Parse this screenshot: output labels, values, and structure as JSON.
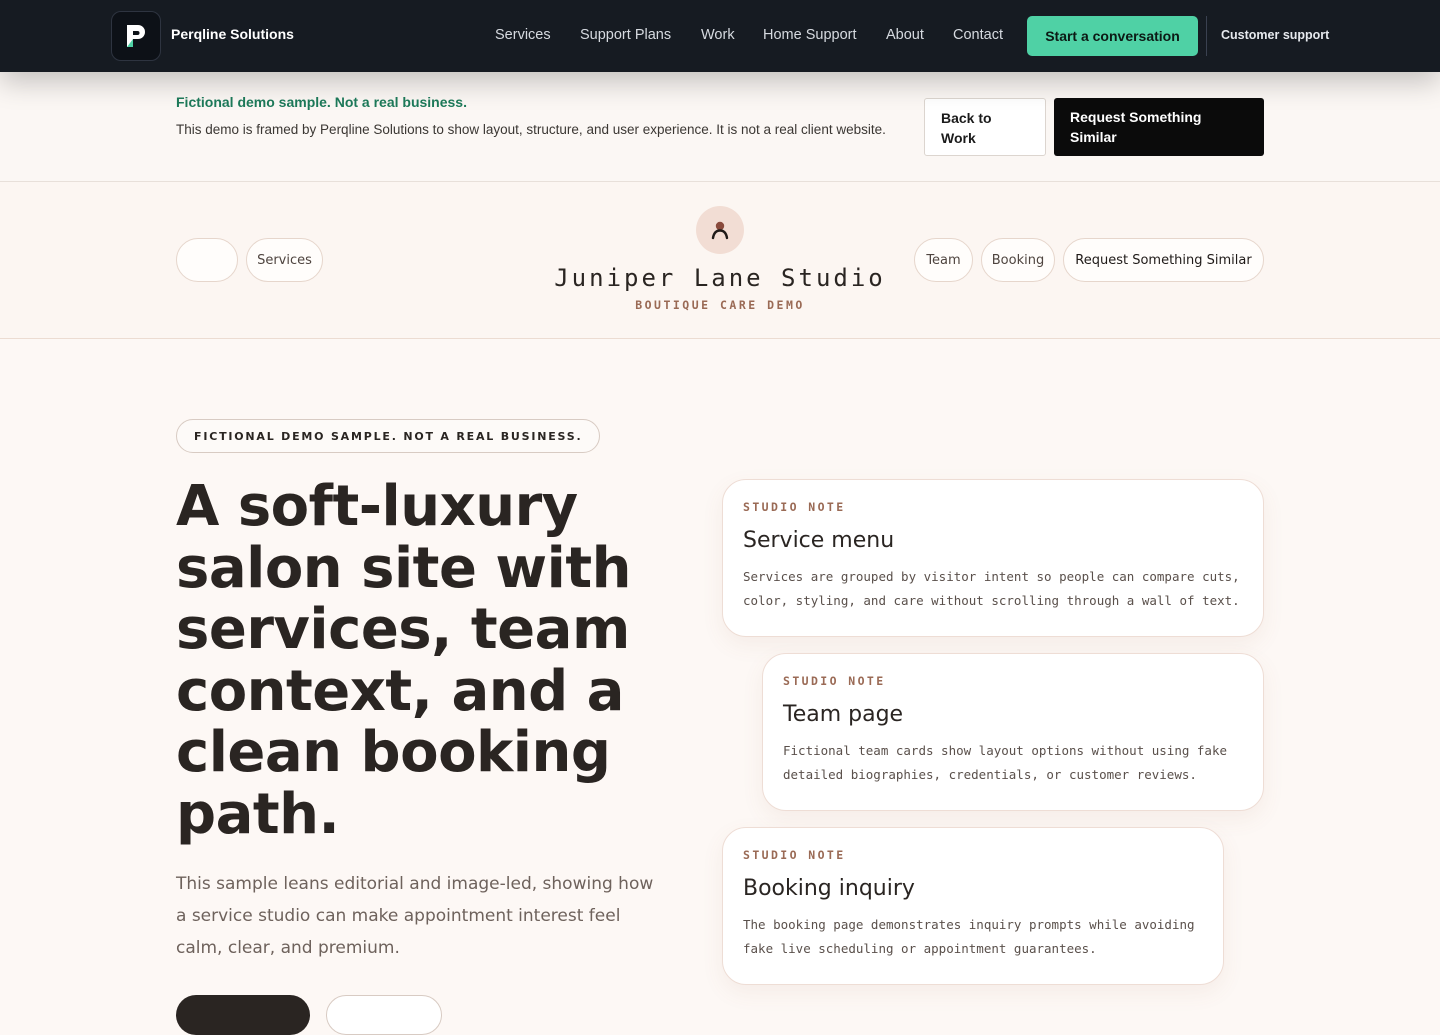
{
  "topbar": {
    "brand": "Perqline Solutions",
    "logo_letter": "P",
    "nav": [
      "Services",
      "Support Plans",
      "Work",
      "Home Support",
      "About",
      "Contact"
    ],
    "cta": "Start a conversation",
    "support": "Customer support"
  },
  "notice": {
    "title": "Fictional demo sample. Not a real business.",
    "text": "This demo is framed by Perqline Solutions to show layout, structure, and user experience. It is not a real client website.",
    "back_button": "Back to Work",
    "similar_button": "Request Something Similar"
  },
  "studio": {
    "name": "Juniper Lane Studio",
    "subtitle": "BOUTIQUE CARE DEMO",
    "left_pills": [
      "",
      "Services"
    ],
    "right_pills": [
      "Team",
      "Booking",
      "Request Something Similar"
    ]
  },
  "hero": {
    "tag": "FICTIONAL DEMO SAMPLE. NOT A REAL BUSINESS.",
    "headline": "A soft-luxury salon site with services, team context, and a clean booking path.",
    "lead": "This sample leans editorial and image-led, showing how a service studio can make appointment interest feel calm, clear, and premium."
  },
  "cards": [
    {
      "kicker": "STUDIO NOTE",
      "title": "Service menu",
      "text": "Services are grouped by visitor intent so people can compare cuts, color, styling, and care without scrolling through a wall of text."
    },
    {
      "kicker": "STUDIO NOTE",
      "title": "Team page",
      "text": "Fictional team cards show layout options without using fake detailed biographies, credentials, or customer reviews."
    },
    {
      "kicker": "STUDIO NOTE",
      "title": "Booking inquiry",
      "text": "The booking page demonstrates inquiry prompts while avoiding fake live scheduling or appointment guarantees."
    }
  ],
  "colors": {
    "topbar_bg": "#161b22",
    "cta_green": "#4fd1a5",
    "notice_green": "#1d7a5a",
    "accent_rose": "#9a6a55",
    "page_bg": "#fdf8f5"
  }
}
